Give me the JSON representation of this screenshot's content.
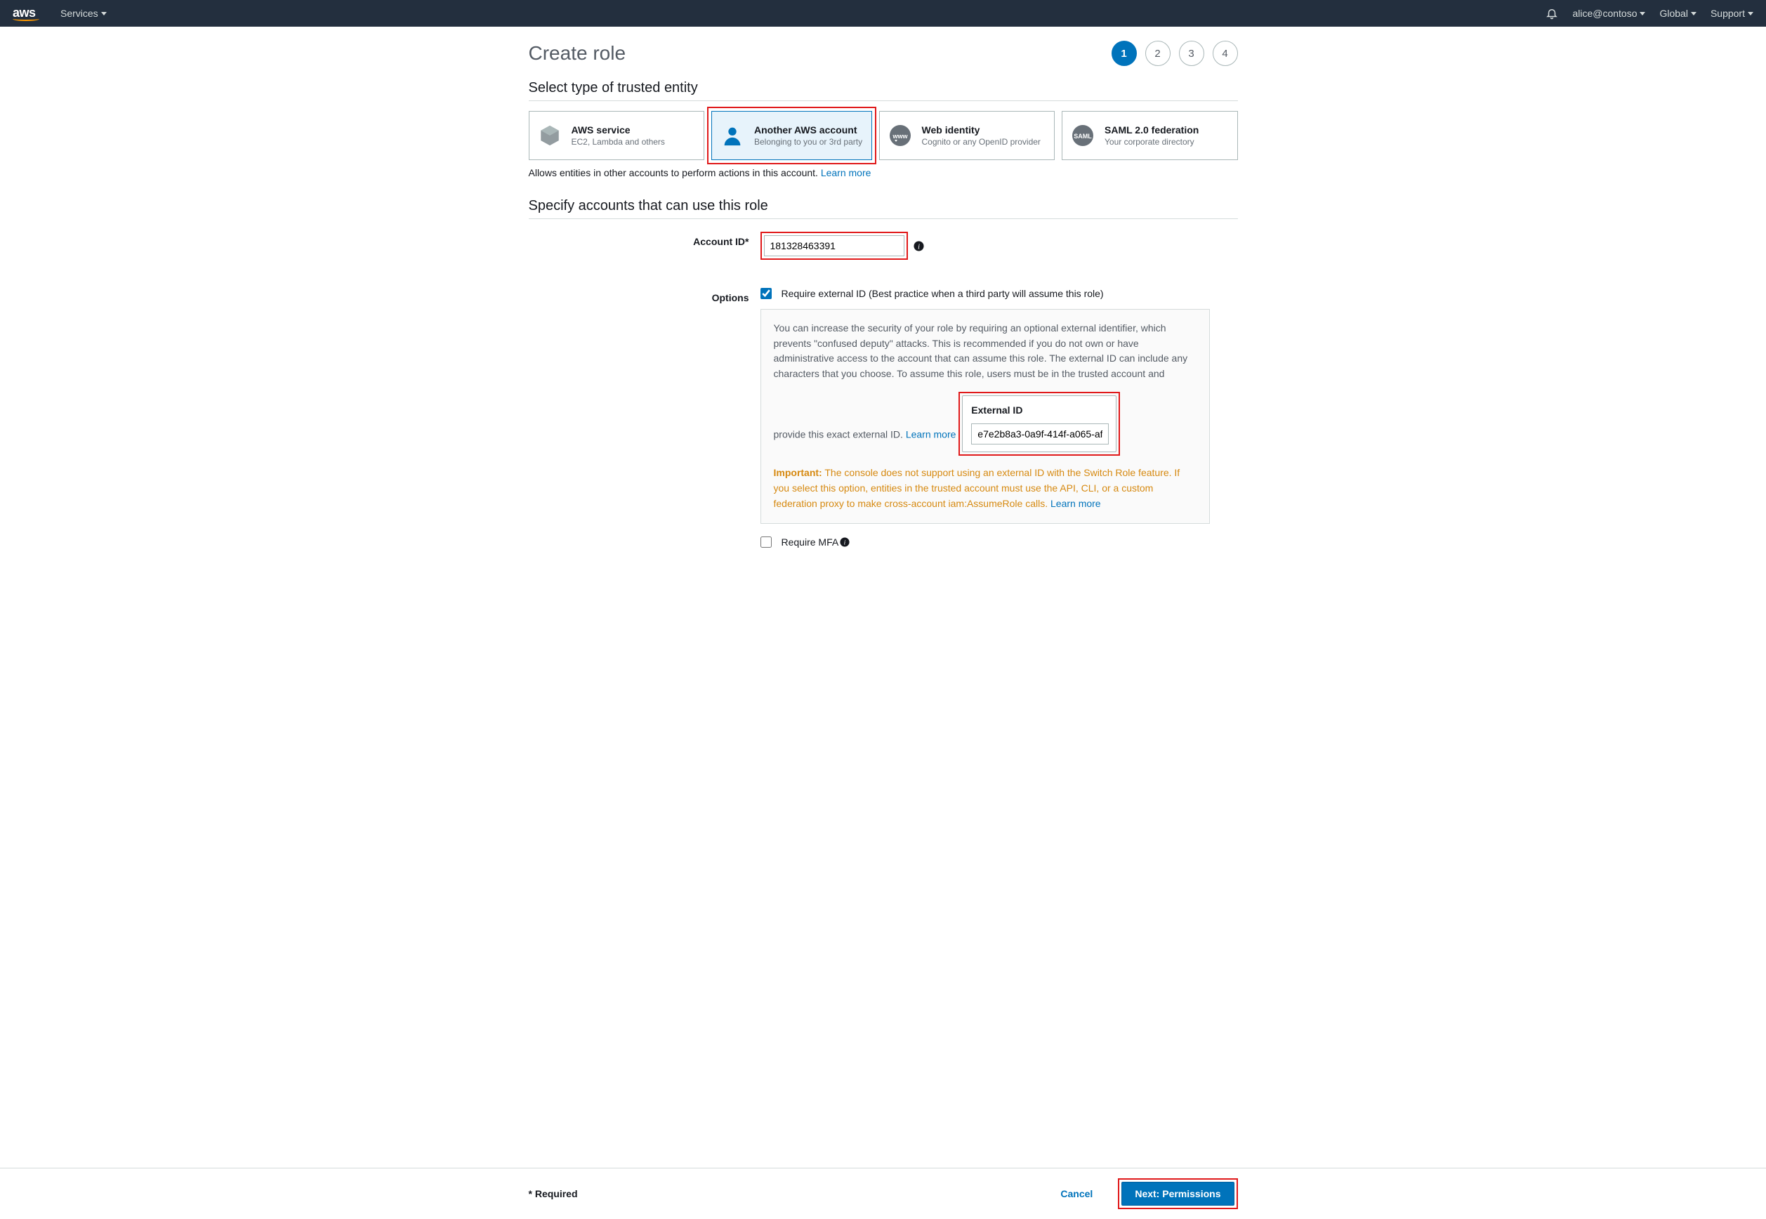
{
  "nav": {
    "logo_text": "aws",
    "services_label": "Services",
    "user_label": "alice@contoso",
    "region_label": "Global",
    "support_label": "Support"
  },
  "page_title": "Create role",
  "steps": [
    "1",
    "2",
    "3",
    "4"
  ],
  "active_step_index": 0,
  "section1_title": "Select type of trusted entity",
  "tiles": [
    {
      "title": "AWS service",
      "sub": "EC2, Lambda and others",
      "icon": "cube"
    },
    {
      "title": "Another AWS account",
      "sub": "Belonging to you or 3rd party",
      "icon": "person"
    },
    {
      "title": "Web identity",
      "sub": "Cognito or any OpenID provider",
      "icon": "www"
    },
    {
      "title": "SAML 2.0 federation",
      "sub": "Your corporate directory",
      "icon": "saml"
    }
  ],
  "selected_tile_index": 1,
  "entity_desc": "Allows entities in other accounts to perform actions in this account. ",
  "learn_more": "Learn more",
  "section2_title": "Specify accounts that can use this role",
  "account_id_label": "Account ID*",
  "account_id_value": "181328463391",
  "options_label": "Options",
  "require_ext_id_label": "Require external ID (Best practice when a third party will assume this role)",
  "require_ext_id_checked": true,
  "ext_panel_text": "You can increase the security of your role by requiring an optional external identifier, which prevents \"confused deputy\" attacks. This is recommended if you do not own or have administrative access to the account that can assume this role. The external ID can include any characters that you choose. To assume this role, users must be in the trusted account and provide this exact external ID. ",
  "external_id_title": "External ID",
  "external_id_value": "e7e2b8a3-0a9f-414f-a065-af",
  "important_label": "Important:",
  "important_text": " The console does not support using an external ID with the Switch Role feature. If you select this option, entities in the trusted account must use the API, CLI, or a custom federation proxy to make cross-account iam:AssumeRole calls. ",
  "require_mfa_label": "Require MFA",
  "require_mfa_checked": false,
  "footer": {
    "required_note": "* Required",
    "cancel": "Cancel",
    "next": "Next: Permissions"
  }
}
